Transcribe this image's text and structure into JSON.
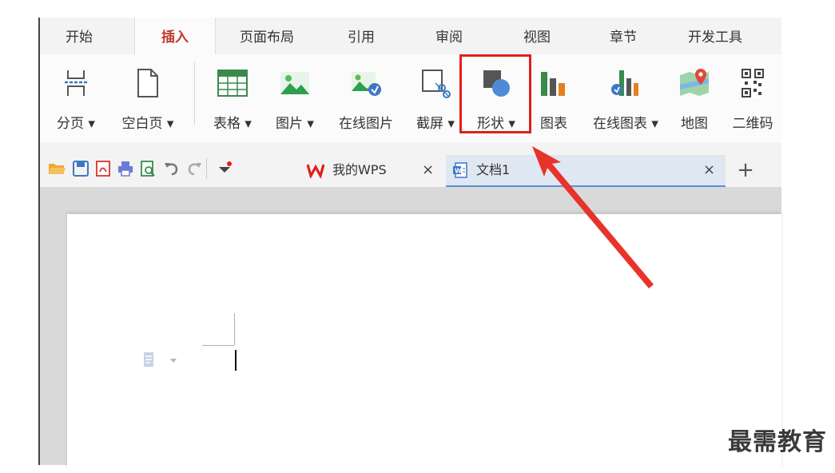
{
  "menu_tabs": [
    {
      "label": "开始"
    },
    {
      "label": "插入"
    },
    {
      "label": "页面布局"
    },
    {
      "label": "引用"
    },
    {
      "label": "审阅"
    },
    {
      "label": "视图"
    },
    {
      "label": "章节"
    },
    {
      "label": "开发工具"
    }
  ],
  "ribbon": {
    "page_break": "分页 ▾",
    "blank_page": "空白页 ▾",
    "table": "表格 ▾",
    "picture": "图片 ▾",
    "online_picture": "在线图片",
    "screenshot": "截屏 ▾",
    "shape": "形状 ▾",
    "chart": "图表",
    "online_chart": "在线图表 ▾",
    "map": "地图",
    "qrcode": "二维码"
  },
  "doc_tabs": {
    "my_wps": "我的WPS",
    "document": "文档1",
    "close": "×",
    "add": "+"
  },
  "colors": {
    "highlight": "#e0201b",
    "active_tab_text": "#c0392b",
    "arrow": "#e8332b"
  },
  "watermark": "最需教育"
}
